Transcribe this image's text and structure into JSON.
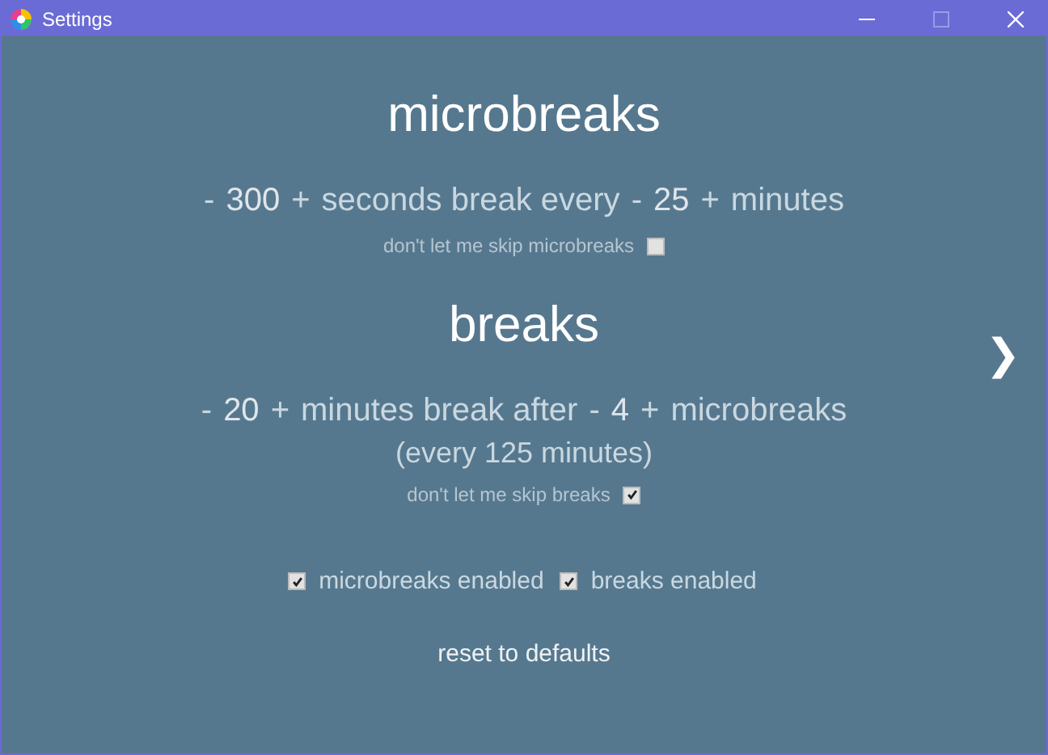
{
  "window": {
    "title": "Settings"
  },
  "microbreaks": {
    "heading": "microbreaks",
    "sentence": [
      {
        "kind": "button",
        "text": "-"
      },
      {
        "kind": "value",
        "text": "300"
      },
      {
        "kind": "button",
        "text": "+"
      },
      {
        "kind": "text",
        "text": "seconds break every"
      },
      {
        "kind": "button",
        "text": "-"
      },
      {
        "kind": "value",
        "text": "25"
      },
      {
        "kind": "button",
        "text": "+"
      },
      {
        "kind": "text",
        "text": "minutes"
      }
    ],
    "strict": {
      "label": "don't let me skip microbreaks",
      "checked": false
    }
  },
  "breaks": {
    "heading": "breaks",
    "sentence": [
      {
        "kind": "button",
        "text": "-"
      },
      {
        "kind": "value",
        "text": "20"
      },
      {
        "kind": "button",
        "text": "+"
      },
      {
        "kind": "text",
        "text": "minutes break after"
      },
      {
        "kind": "button",
        "text": "-"
      },
      {
        "kind": "value",
        "text": "4"
      },
      {
        "kind": "button",
        "text": "+"
      },
      {
        "kind": "text",
        "text": "microbreaks"
      }
    ],
    "interval": "(every 125 minutes)",
    "strict": {
      "label": "don't let me skip breaks",
      "checked": true
    }
  },
  "next_button": "❯",
  "toggles": [
    {
      "label": "microbreaks enabled",
      "checked": true
    },
    {
      "label": "breaks enabled",
      "checked": true
    }
  ],
  "reset_button": "reset to defaults"
}
